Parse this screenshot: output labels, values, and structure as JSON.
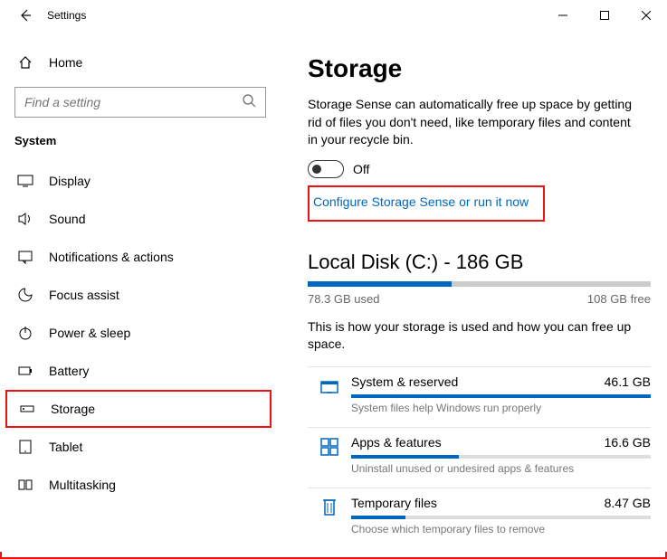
{
  "window": {
    "title": "Settings"
  },
  "sidebar": {
    "home": "Home",
    "search_placeholder": "Find a setting",
    "section": "System",
    "items": [
      {
        "label": "Display"
      },
      {
        "label": "Sound"
      },
      {
        "label": "Notifications & actions"
      },
      {
        "label": "Focus assist"
      },
      {
        "label": "Power & sleep"
      },
      {
        "label": "Battery"
      },
      {
        "label": "Storage"
      },
      {
        "label": "Tablet"
      },
      {
        "label": "Multitasking"
      }
    ]
  },
  "main": {
    "title": "Storage",
    "description": "Storage Sense can automatically free up space by getting rid of files you don't need, like temporary files and content in your recycle bin.",
    "toggle_state": "Off",
    "configure_link": "Configure Storage Sense or run it now",
    "disk_title": "Local Disk (C:) - 186 GB",
    "used_label": "78.3 GB used",
    "free_label": "108 GB free",
    "used_percent": 42,
    "howtext": "This is how your storage is used and how you can free up space.",
    "categories": [
      {
        "name": "System & reserved",
        "size": "46.1 GB",
        "sub": "System files help Windows run properly",
        "percent": 100
      },
      {
        "name": "Apps & features",
        "size": "16.6 GB",
        "sub": "Uninstall unused or undesired apps & features",
        "percent": 36
      },
      {
        "name": "Temporary files",
        "size": "8.47 GB",
        "sub": "Choose which temporary files to remove",
        "percent": 18
      }
    ]
  }
}
